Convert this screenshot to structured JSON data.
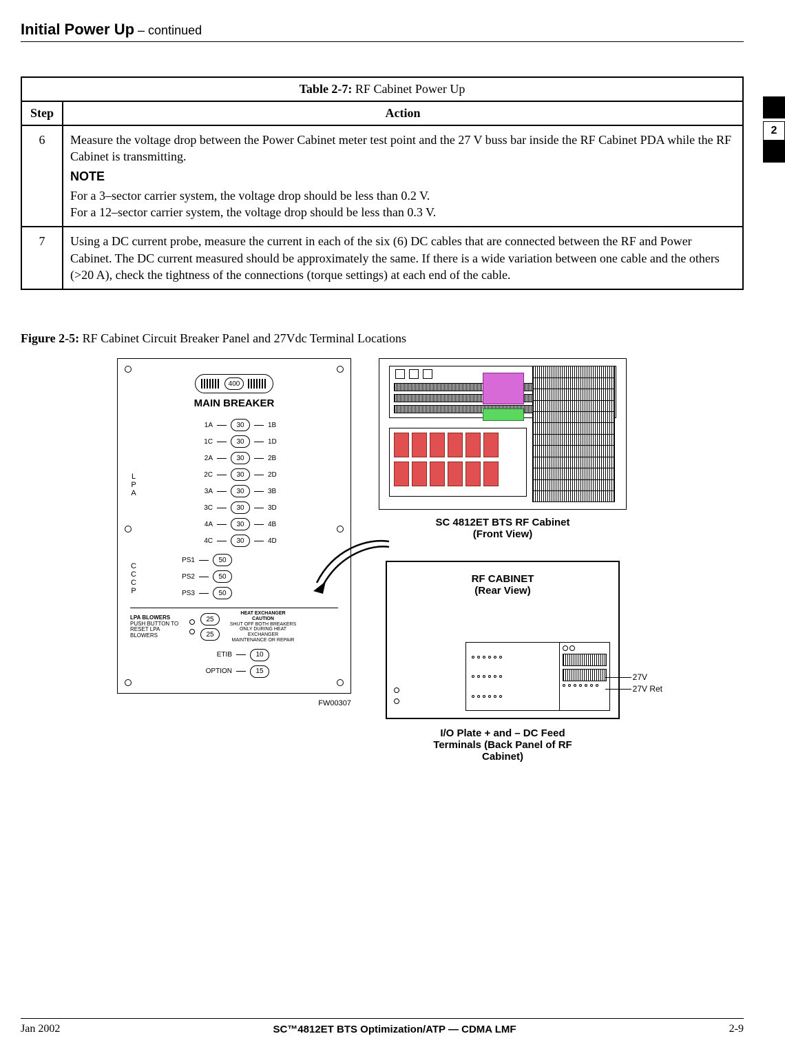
{
  "page": {
    "title": "Initial Power Up",
    "continued": " – continued"
  },
  "sidetab": {
    "num": "2"
  },
  "table": {
    "caption_prefix": "Table 2-7: ",
    "caption_text": "RF Cabinet Power Up",
    "headers": {
      "step": "Step",
      "action": "Action"
    },
    "rows": [
      {
        "step": "6",
        "action_p1": "Measure the voltage drop between the Power Cabinet meter test point and the 27 V buss bar inside the RF Cabinet PDA while the RF Cabinet is transmitting.",
        "note_label": "NOTE",
        "note_p1": "For a 3–sector carrier system, the voltage drop should be less than 0.2 V.",
        "note_p2": "For a 12–sector carrier system, the voltage drop should be less than 0.3 V."
      },
      {
        "step": "7",
        "action_p1": "Using a DC current probe, measure the current in each of the six (6) DC cables that are connected between the RF and Power Cabinet. The DC current measured should be approximately the same. If there is a wide variation between one cable and the others (>20 A), check the tightness of the connections (torque settings) at each end of the cable."
      }
    ]
  },
  "figure": {
    "prefix": "Figure 2-5: ",
    "caption": "RF Cabinet Circuit Breaker Panel and 27Vdc Terminal Locations",
    "main_breaker_val": "400",
    "main_breaker_label": "MAIN BREAKER",
    "lpa_label_letters": [
      "L",
      "P",
      "A"
    ],
    "lpa_breakers": [
      {
        "left": "1A",
        "val": "30",
        "right": "1B"
      },
      {
        "left": "1C",
        "val": "30",
        "right": "1D"
      },
      {
        "left": "2A",
        "val": "30",
        "right": "2B"
      },
      {
        "left": "2C",
        "val": "30",
        "right": "2D"
      },
      {
        "left": "3A",
        "val": "30",
        "right": "3B"
      },
      {
        "left": "3C",
        "val": "30",
        "right": "3D"
      },
      {
        "left": "4A",
        "val": "30",
        "right": "4B"
      },
      {
        "left": "4C",
        "val": "30",
        "right": "4D"
      }
    ],
    "cccp_label_letters": [
      "C",
      "C",
      "C",
      "P"
    ],
    "cccp_breakers": [
      {
        "left": "PS1",
        "val": "50"
      },
      {
        "left": "PS2",
        "val": "50"
      },
      {
        "left": "PS3",
        "val": "50"
      }
    ],
    "lpa_blowers": {
      "title": "LPA BLOWERS",
      "sub": "PUSH BUTTON TO RESET LPA BLOWERS"
    },
    "heat_exchanger": {
      "vals": [
        "25",
        "25"
      ],
      "title": "HEAT EXCHANGER",
      "caution": "CAUTION",
      "text1": "SHUT OFF BOTH BREAKERS",
      "text2": "ONLY DURING HEAT EXCHANGER",
      "text3": "MAINTENANCE OR REPAIR"
    },
    "bottom_breakers": [
      {
        "left": "ETIB",
        "val": "10"
      },
      {
        "left": "OPTION",
        "val": "15"
      }
    ],
    "fw": "FW00307",
    "front_label_l1": "SC 4812ET BTS RF Cabinet",
    "front_label_l2": "(Front View)",
    "rear_title_l1": "RF CABINET",
    "rear_title_l2": "(Rear View)",
    "v27": "27V",
    "v27ret": "27V Ret",
    "io_caption_l1": "I/O Plate + and – DC Feed",
    "io_caption_l2": "Terminals (Back Panel of RF",
    "io_caption_l3": "Cabinet)"
  },
  "footer": {
    "left": "Jan 2002",
    "center": "SC™4812ET BTS Optimization/ATP — CDMA LMF",
    "right": "2-9"
  }
}
